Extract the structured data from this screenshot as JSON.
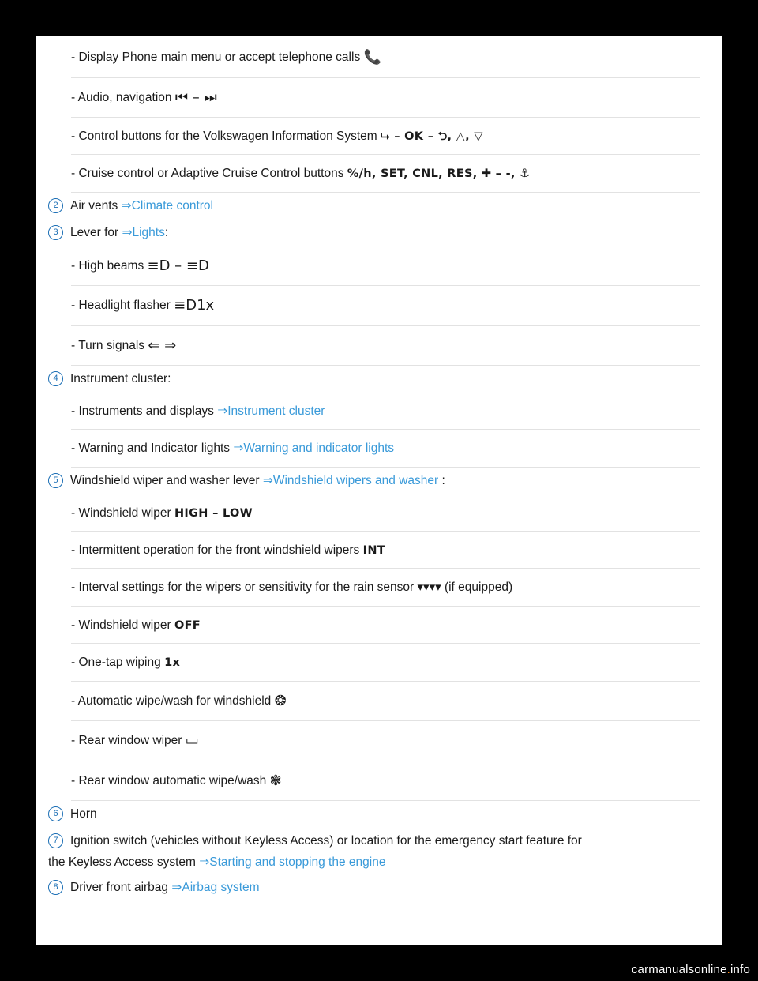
{
  "document": {
    "rows": [
      {
        "type": "sub",
        "prefix": "-",
        "text": "Display Phone main menu or accept telephone calls",
        "glyphs": "📞"
      },
      {
        "type": "sub",
        "prefix": "-",
        "text": "Audio, navigation",
        "glyphs": "⏮ – ⏭"
      },
      {
        "type": "sub",
        "prefix": "-",
        "text": "Control buttons for the Volkswagen Information System",
        "glyphs": "⮡ – OK – ⮌, △, ▽"
      },
      {
        "type": "sub",
        "prefix": "-",
        "text": "Cruise control or Adaptive Cruise Control buttons",
        "glyphs": "%/h, SET, CNL, RES, ✚ –  -, ⚓"
      },
      {
        "type": "num",
        "number": "2",
        "text": "Air vents",
        "arrow": "⇒",
        "link": "Climate control",
        "suffix": ""
      },
      {
        "type": "num",
        "number": "3",
        "text": "Lever for",
        "arrow": "⇒",
        "link": "Lights",
        "suffix": ":"
      },
      {
        "type": "sub",
        "prefix": "-",
        "text": "High beams",
        "glyphs": "≡D – ≡D"
      },
      {
        "type": "sub",
        "prefix": "-",
        "text": "Headlight flasher",
        "glyphs": "≡D1x"
      },
      {
        "type": "sub",
        "prefix": "-",
        "text": "Turn signals",
        "glyphs": "⇐ ⇒"
      },
      {
        "type": "num",
        "number": "4",
        "text": "Instrument cluster:",
        "arrow": "",
        "link": "",
        "suffix": ""
      },
      {
        "type": "sub",
        "prefix": "-",
        "text": "Instruments and displays",
        "arrow": "⇒",
        "link": "Instrument cluster"
      },
      {
        "type": "sub",
        "prefix": "-",
        "text": "Warning and Indicator lights",
        "arrow": "⇒",
        "link": "Warning and indicator lights"
      },
      {
        "type": "num",
        "number": "5",
        "text": "Windshield wiper and washer lever",
        "arrow": "⇒",
        "link": "Windshield wipers and washer",
        "suffix": ":"
      },
      {
        "type": "sub",
        "prefix": "-",
        "text": "Windshield wiper",
        "glyphs": "HIGH – LOW"
      },
      {
        "type": "sub",
        "prefix": "-",
        "text": "Intermittent operation for the front windshield wipers",
        "glyphs": "INT"
      },
      {
        "type": "sub",
        "prefix": "-",
        "text": "Interval settings for the wipers or sensitivity for the rain sensor",
        "glyphs": "▾▾▾▾",
        "tail": "(if equipped)"
      },
      {
        "type": "sub",
        "prefix": "-",
        "text": "Windshield wiper",
        "glyphs": "OFF"
      },
      {
        "type": "sub",
        "prefix": "-",
        "text": "One-tap wiping",
        "glyphs": "1x"
      },
      {
        "type": "sub",
        "prefix": "-",
        "text": "Automatic wipe/wash for windshield",
        "glyphs": "❂"
      },
      {
        "type": "sub",
        "prefix": "-",
        "text": "Rear window wiper",
        "glyphs": "▭"
      },
      {
        "type": "sub",
        "prefix": "-",
        "text": "Rear window automatic wipe/wash",
        "glyphs": "❃"
      },
      {
        "type": "num",
        "number": "6",
        "text": "Horn",
        "arrow": "",
        "link": "",
        "suffix": ""
      },
      {
        "type": "num",
        "number": "7",
        "text": "Ignition switch (vehicles without Keyless Access) or location for the emergency start feature for",
        "arrow": "",
        "link": "",
        "suffix": ""
      },
      {
        "type": "cont",
        "text": "the Keyless Access system",
        "arrow": "⇒",
        "link": "Starting and stopping the engine"
      },
      {
        "type": "num",
        "number": "8",
        "text": "Driver front airbag",
        "arrow": "⇒",
        "link": "Airbag system",
        "suffix": ""
      }
    ]
  },
  "watermark": {
    "text_before": "carmanualsonline",
    "dot": ".",
    "text_after": "info"
  },
  "colors": {
    "link": "#3a9ad9",
    "badge": "#1c6fb5",
    "text": "#1a1a1a",
    "page_background": "#ffffff",
    "outer_background": "#000000",
    "rule": "#e2e2e2",
    "watermark_dot": "#ff8c1a"
  }
}
